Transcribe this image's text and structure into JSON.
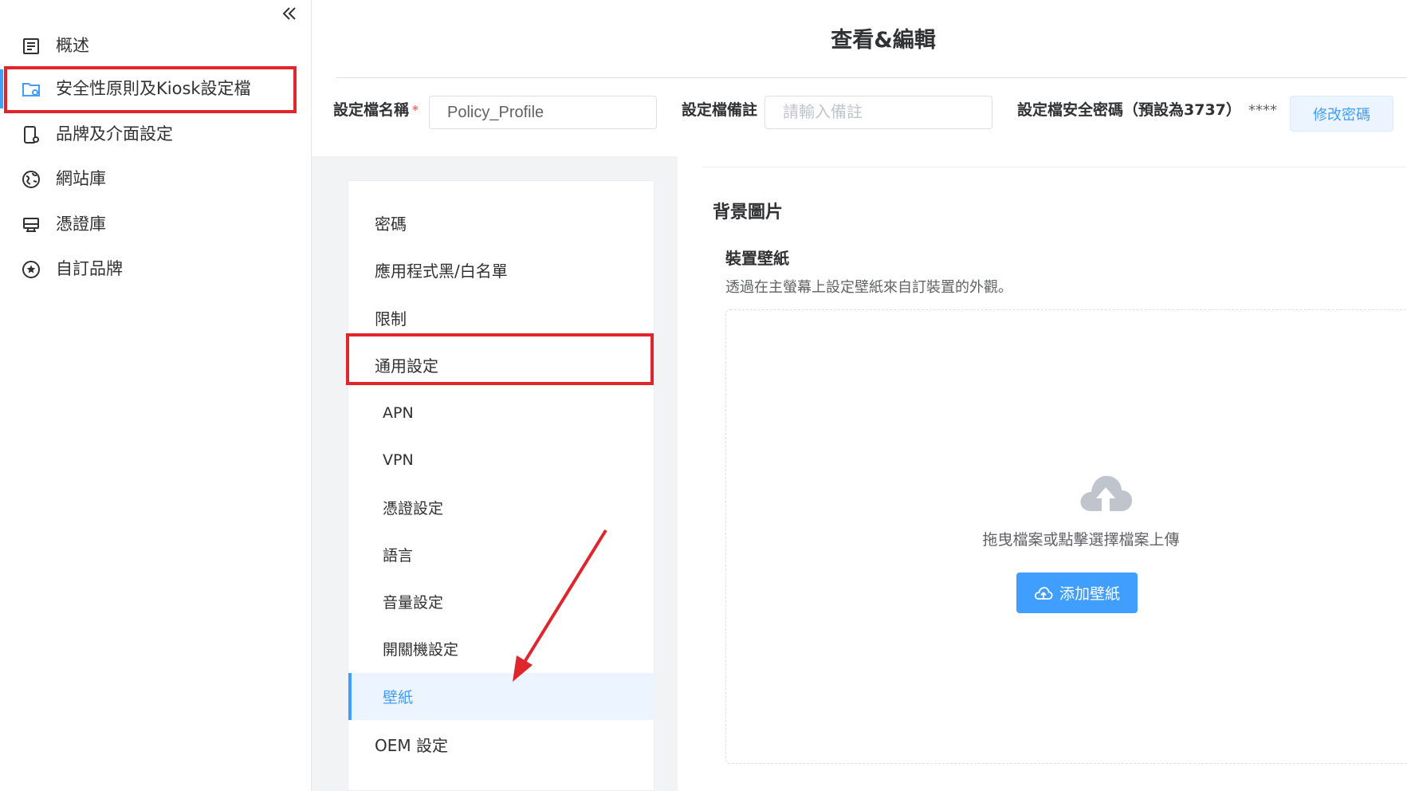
{
  "sidebar": {
    "items": [
      {
        "label": "概述",
        "icon": "document-list-icon"
      },
      {
        "label": "安全性原則及Kiosk設定檔",
        "icon": "folder-settings-icon"
      },
      {
        "label": "品牌及介面設定",
        "icon": "device-settings-icon"
      },
      {
        "label": "網站庫",
        "icon": "globe-icon"
      },
      {
        "label": "憑證庫",
        "icon": "monitor-icon"
      },
      {
        "label": "自訂品牌",
        "icon": "star-circle-icon"
      }
    ],
    "active_index": 1
  },
  "header": {
    "title": "查看&編輯",
    "profile_name_label": "設定檔名稱",
    "required_mark": "*",
    "profile_name_value": "Policy_Profile",
    "note_label": "設定檔備註",
    "note_placeholder": "請輸入備註",
    "password_label": "設定檔安全密碼（預設為3737）",
    "password_mask": "****",
    "change_password_button": "修改密碼"
  },
  "settings_menu": {
    "items": [
      {
        "label": "密碼",
        "level": "top"
      },
      {
        "label": "應用程式黑/白名單",
        "level": "top"
      },
      {
        "label": "限制",
        "level": "top"
      },
      {
        "label": "通用設定",
        "level": "top"
      },
      {
        "label": "APN",
        "level": "sub"
      },
      {
        "label": "VPN",
        "level": "sub"
      },
      {
        "label": "憑證設定",
        "level": "sub"
      },
      {
        "label": "語言",
        "level": "sub"
      },
      {
        "label": "音量設定",
        "level": "sub"
      },
      {
        "label": "開關機設定",
        "level": "sub"
      },
      {
        "label": "壁紙",
        "level": "sub",
        "selected": true
      },
      {
        "label": "OEM 設定",
        "level": "top"
      }
    ]
  },
  "content": {
    "section_title": "背景圖片",
    "subsection_title": "裝置壁紙",
    "subsection_desc": "透過在主螢幕上設定壁紙來自訂裝置的外觀。",
    "upload_text": "拖曳檔案或點擊選擇檔案上傳",
    "add_button": "添加壁紙",
    "upload_icon": "cloud-upload-icon"
  },
  "colors": {
    "accent": "#409eff",
    "highlight_red": "#e0252c",
    "selected_bg": "#ecf5ff"
  }
}
